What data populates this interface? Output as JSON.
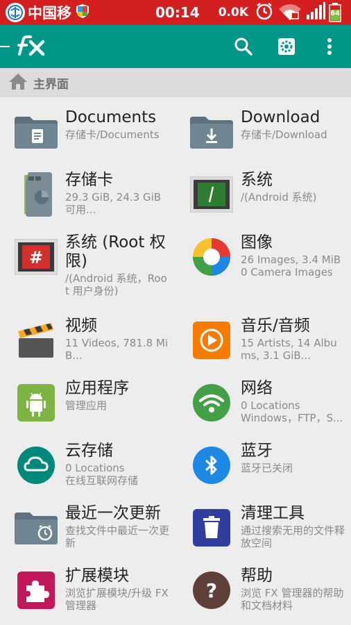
{
  "status_bar": {
    "carrier": "中国移",
    "time": "00:14",
    "net_speed": "0.0K",
    "battery": "64"
  },
  "toolbar": {
    "logo_text": "FX",
    "icons": [
      "search-icon",
      "settings-icon",
      "overflow-menu-icon"
    ]
  },
  "breadcrumb": {
    "label": "主界面"
  },
  "items": [
    {
      "title": "Documents",
      "sub": "存储卡/Documents",
      "icon": "folder-documents-icon"
    },
    {
      "title": "Download",
      "sub": "存储卡/Download",
      "icon": "folder-download-icon"
    },
    {
      "title": "存储卡",
      "sub": "29.3 GiB, 24.3 GiB 可用...",
      "icon": "sd-card-icon"
    },
    {
      "title": "系统",
      "sub": "/(Android 系统)",
      "icon": "system-icon"
    },
    {
      "title": "系统 (Root 权限)",
      "sub": "/(Android 系统，Root 用户身份)",
      "icon": "root-system-icon"
    },
    {
      "title": "图像",
      "sub": "26 Images, 3.4 MiB\n0 Camera Images",
      "icon": "images-icon"
    },
    {
      "title": "视频",
      "sub": "11 Videos, 781.8 MiB...",
      "icon": "video-icon"
    },
    {
      "title": "音乐/音频",
      "sub": "15 Artists, 14 Albums, 3.1 GiB...",
      "icon": "music-icon"
    },
    {
      "title": "应用程序",
      "sub": "管理应用",
      "icon": "apps-icon"
    },
    {
      "title": "网络",
      "sub": "0 Locations\nWindows，FTP，S...",
      "icon": "network-icon"
    },
    {
      "title": "云存储",
      "sub": "0 Locations\n在线互联网存储",
      "icon": "cloud-icon"
    },
    {
      "title": "蓝牙",
      "sub": "蓝牙已关闭",
      "icon": "bluetooth-icon"
    },
    {
      "title": "最近一次更新",
      "sub": "查找文件中最近一次更新",
      "icon": "recent-icon"
    },
    {
      "title": "清理工具",
      "sub": "通过搜索无用的文件释放空间",
      "icon": "cleaner-icon"
    },
    {
      "title": "扩展模块",
      "sub": "浏览扩展模块/升级 FX 管理器",
      "icon": "extensions-icon"
    },
    {
      "title": "帮助",
      "sub": "浏览 FX 管理器的帮助和文档材料",
      "icon": "help-icon"
    }
  ],
  "colors": {
    "status_bar": "#d31f1f",
    "toolbar": "#009688",
    "breadcrumb": "#dcdcdc"
  }
}
